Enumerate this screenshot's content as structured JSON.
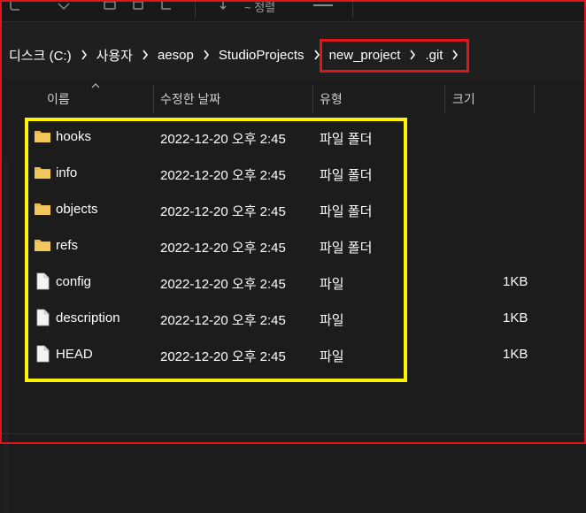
{
  "toolbar": {
    "label": "~ 정렬"
  },
  "breadcrumb": [
    "디스크 (C:)",
    "사용자",
    "aesop",
    "StudioProjects",
    "new_project",
    ".git"
  ],
  "columns": {
    "name": "이름",
    "modified": "수정한 날짜",
    "type": "유형",
    "size": "크기"
  },
  "files": [
    {
      "name": "hooks",
      "modified": "2022-12-20 오후 2:45",
      "type": "파일 폴더",
      "size": "",
      "icon": "folder-icon"
    },
    {
      "name": "info",
      "modified": "2022-12-20 오후 2:45",
      "type": "파일 폴더",
      "size": "",
      "icon": "folder-icon"
    },
    {
      "name": "objects",
      "modified": "2022-12-20 오후 2:45",
      "type": "파일 폴더",
      "size": "",
      "icon": "folder-icon"
    },
    {
      "name": "refs",
      "modified": "2022-12-20 오후 2:45",
      "type": "파일 폴더",
      "size": "",
      "icon": "folder-icon"
    },
    {
      "name": "config",
      "modified": "2022-12-20 오후 2:45",
      "type": "파일",
      "size": "1KB",
      "icon": "file-icon"
    },
    {
      "name": "description",
      "modified": "2022-12-20 오후 2:45",
      "type": "파일",
      "size": "1KB",
      "icon": "file-icon"
    },
    {
      "name": "HEAD",
      "modified": "2022-12-20 오후 2:45",
      "type": "파일",
      "size": "1KB",
      "icon": "file-icon"
    }
  ],
  "colors": {
    "highlight_address": "#e0161d",
    "highlight_files": "#fff200",
    "folder": "#e8b84a",
    "background": "#1c1c1c"
  }
}
